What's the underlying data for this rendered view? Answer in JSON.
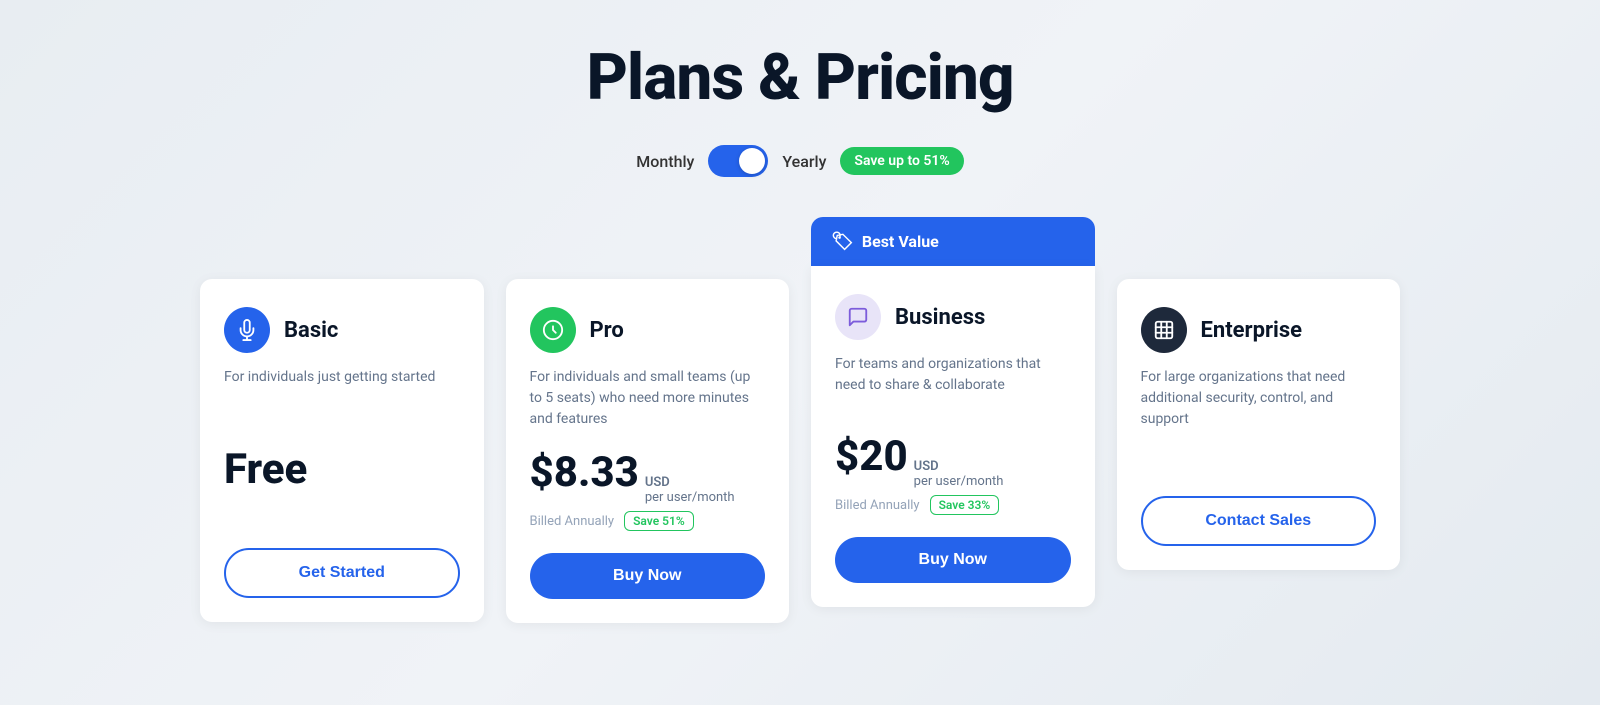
{
  "page": {
    "title": "Plans & Pricing"
  },
  "billing": {
    "monthly_label": "Monthly",
    "yearly_label": "Yearly",
    "save_badge": "Save up to 51%"
  },
  "plans": [
    {
      "id": "basic",
      "name": "Basic",
      "icon_type": "basic",
      "icon_symbol": "🎤",
      "description": "For individuals just getting started",
      "price_display": "Free",
      "price_amount": null,
      "currency": null,
      "period": null,
      "billing_note": null,
      "save_tag": null,
      "button_label": "Get Started",
      "button_type": "outline",
      "best_value": false
    },
    {
      "id": "pro",
      "name": "Pro",
      "icon_type": "pro",
      "icon_symbol": "🎙",
      "description": "For individuals and small teams (up to 5 seats) who need more minutes and features",
      "price_display": null,
      "price_amount": "$8.33",
      "currency": "USD",
      "period": "per user/month",
      "billing_note": "Billed Annually",
      "save_tag": "Save 51%",
      "button_label": "Buy Now",
      "button_type": "primary",
      "best_value": false
    },
    {
      "id": "business",
      "name": "Business",
      "icon_type": "business",
      "icon_symbol": "💬",
      "description": "For teams and organizations that need to share & collaborate",
      "price_display": null,
      "price_amount": "$20",
      "currency": "USD",
      "period": "per user/month",
      "billing_note": "Billed Annually",
      "save_tag": "Save 33%",
      "button_label": "Buy Now",
      "button_type": "primary",
      "best_value": true,
      "best_value_label": "Best Value"
    },
    {
      "id": "enterprise",
      "name": "Enterprise",
      "icon_type": "enterprise",
      "icon_symbol": "🏢",
      "description": "For large organizations that need additional security, control, and support",
      "price_display": null,
      "price_amount": null,
      "currency": null,
      "period": null,
      "billing_note": null,
      "save_tag": null,
      "button_label": "Contact Sales",
      "button_type": "outline",
      "best_value": false
    }
  ]
}
